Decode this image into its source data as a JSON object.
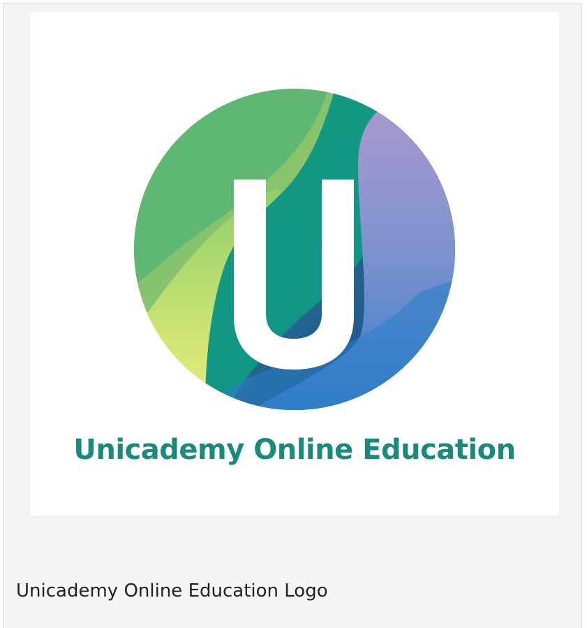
{
  "logo": {
    "wordmark": "Unicademy Online Education",
    "monogram": "U",
    "colors": {
      "wordmark": "#1a8a7c",
      "green": "#5db873",
      "teal": "#0e9a86",
      "purple": "#a89acd",
      "blue": "#2b7cc8",
      "yellow": "#ecf07a",
      "orange": "#e49a5e"
    }
  },
  "caption": "Unicademy Online Education Logo"
}
